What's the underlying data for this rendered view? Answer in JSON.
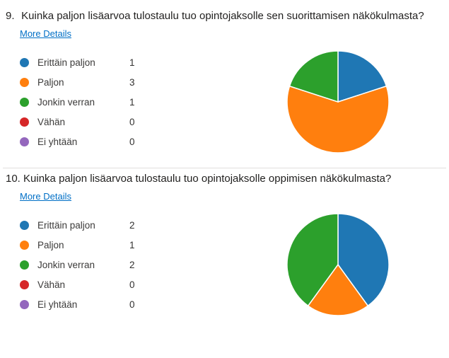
{
  "more_details_label": "More Details",
  "questions": [
    {
      "number": "9.",
      "heading": "Kuinka paljon lisäarvoa tulostaulu tuo opintojaksolle sen suorittamisen näkökulmasta?",
      "options": [
        {
          "label": "Erittäin paljon",
          "value": 1,
          "color": "#1f77b4"
        },
        {
          "label": "Paljon",
          "value": 3,
          "color": "#ff7f0e"
        },
        {
          "label": "Jonkin verran",
          "value": 1,
          "color": "#2ca02c"
        },
        {
          "label": "Vähän",
          "value": 0,
          "color": "#d62728"
        },
        {
          "label": "Ei yhtään",
          "value": 0,
          "color": "#9467bd"
        }
      ]
    },
    {
      "number": "10.",
      "heading": "Kuinka paljon lisäarvoa tulostaulu tuo opintojaksolle oppimisen näkökulmasta?",
      "options": [
        {
          "label": "Erittäin paljon",
          "value": 2,
          "color": "#1f77b4"
        },
        {
          "label": "Paljon",
          "value": 1,
          "color": "#ff7f0e"
        },
        {
          "label": "Jonkin verran",
          "value": 2,
          "color": "#2ca02c"
        },
        {
          "label": "Vähän",
          "value": 0,
          "color": "#d62728"
        },
        {
          "label": "Ei yhtään",
          "value": 0,
          "color": "#9467bd"
        }
      ]
    }
  ],
  "chart_data": [
    {
      "type": "pie",
      "title": "Kuinka paljon lisäarvoa tulostaulu tuo opintojaksolle sen suorittamisen näkökulmasta?",
      "categories": [
        "Erittäin paljon",
        "Paljon",
        "Jonkin verran",
        "Vähän",
        "Ei yhtään"
      ],
      "values": [
        1,
        3,
        1,
        0,
        0
      ]
    },
    {
      "type": "pie",
      "title": "Kuinka paljon lisäarvoa tulostaulu tuo opintojaksolle oppimisen näkökulmasta?",
      "categories": [
        "Erittäin paljon",
        "Paljon",
        "Jonkin verran",
        "Vähän",
        "Ei yhtään"
      ],
      "values": [
        2,
        1,
        2,
        0,
        0
      ]
    }
  ]
}
